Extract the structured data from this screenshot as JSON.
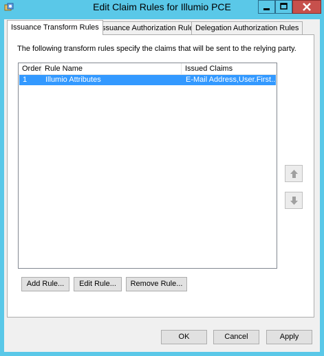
{
  "window": {
    "title": "Edit Claim Rules for Illumio PCE",
    "app_icon": "adfs-snapin-icon"
  },
  "tabs": [
    {
      "label": "Issuance Transform Rules",
      "active": true
    },
    {
      "label": "Issuance Authorization Rules",
      "active": false
    },
    {
      "label": "Delegation Authorization Rules",
      "active": false
    }
  ],
  "panel": {
    "description": "The following transform rules specify the claims that will be sent to the relying party."
  },
  "rules_table": {
    "columns": [
      "Order",
      "Rule Name",
      "Issued Claims"
    ],
    "rows": [
      {
        "order": "1",
        "rule_name": "Illumio Attributes",
        "issued_claims": "E-Mail Address,User.First...",
        "selected": true
      }
    ]
  },
  "rule_buttons": {
    "add": "Add Rule...",
    "edit": "Edit Rule...",
    "remove": "Remove Rule..."
  },
  "dialog_buttons": {
    "ok": "OK",
    "cancel": "Cancel",
    "apply": "Apply"
  },
  "colors": {
    "frame": "#5ac8e8",
    "close_button": "#c7504c",
    "selection": "#3399ff"
  }
}
